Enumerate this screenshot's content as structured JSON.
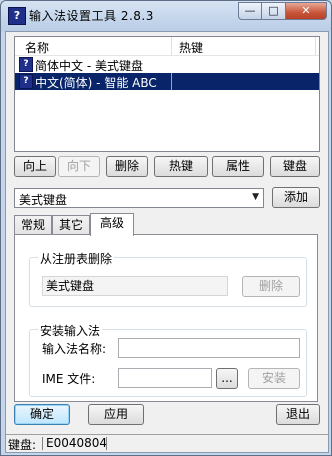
{
  "window": {
    "title": "输入法设置工具 2.8.3",
    "app_icon_glyph": "?",
    "controls": {
      "minimize": "—",
      "maximize": "□",
      "close": "✕"
    }
  },
  "list": {
    "columns": [
      "名称",
      "热键"
    ],
    "rows": [
      {
        "name": "简体中文 - 美式键盘",
        "hotkey": "",
        "selected": false
      },
      {
        "name": "中文(简体) - 智能 ABC",
        "hotkey": "",
        "selected": true
      }
    ]
  },
  "action_buttons": {
    "up": "向上",
    "down": "向下",
    "delete": "删除",
    "hotkey": "热键",
    "properties": "属性",
    "keyboard": "键盘"
  },
  "layout_select": {
    "value": "美式键盘",
    "add_label": "添加"
  },
  "tabs": [
    "常规",
    "其它",
    "高级"
  ],
  "active_tab": "高级",
  "advanced": {
    "registry_group": {
      "title": "从注册表删除",
      "value": "美式键盘",
      "delete_label": "删除"
    },
    "install_group": {
      "title": "安装输入法",
      "ime_name_label": "输入法名称:",
      "ime_name_value": "",
      "ime_file_label": "IME 文件:",
      "ime_file_value": "",
      "browse_label": "...",
      "install_label": "安装"
    }
  },
  "footer": {
    "ok": "确定",
    "apply": "应用",
    "exit": "退出"
  },
  "status": {
    "label": "键盘:",
    "value": "E0040804"
  }
}
